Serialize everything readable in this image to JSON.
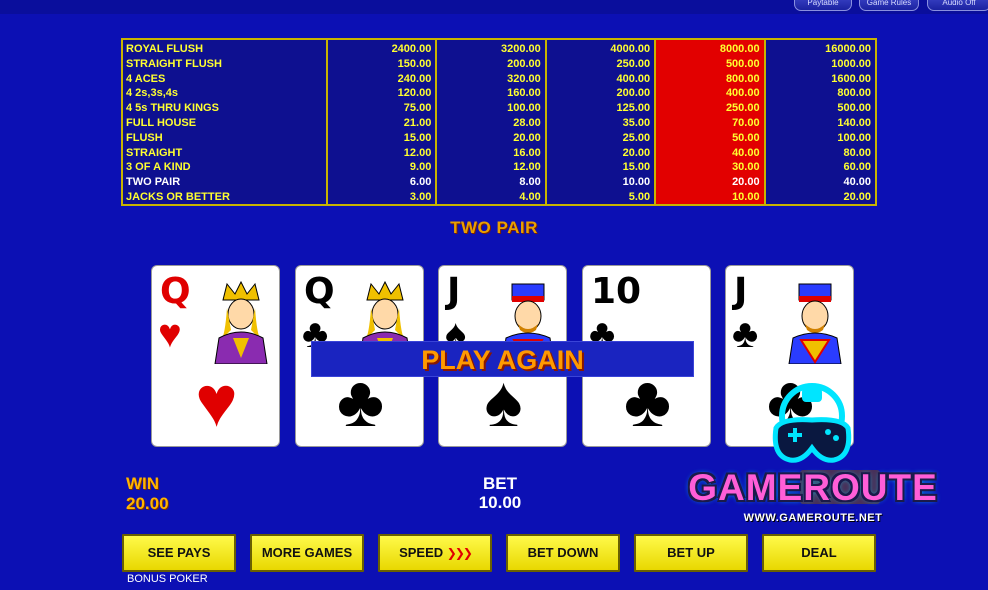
{
  "top_buttons": [
    "Paytable",
    "Game Rules",
    "Audio Off"
  ],
  "paytable": {
    "hands": [
      "ROYAL FLUSH",
      "STRAIGHT FLUSH",
      "4 ACES",
      "4 2s,3s,4s",
      "4 5s THRU KINGS",
      "FULL HOUSE",
      "FLUSH",
      "STRAIGHT",
      "3 OF A KIND",
      "TWO PAIR",
      "JACKS OR BETTER"
    ],
    "columns": [
      [
        "2400.00",
        "150.00",
        "240.00",
        "120.00",
        "75.00",
        "21.00",
        "15.00",
        "12.00",
        "9.00",
        "6.00",
        "3.00"
      ],
      [
        "3200.00",
        "200.00",
        "320.00",
        "160.00",
        "100.00",
        "28.00",
        "20.00",
        "16.00",
        "12.00",
        "8.00",
        "4.00"
      ],
      [
        "4000.00",
        "250.00",
        "400.00",
        "200.00",
        "125.00",
        "35.00",
        "25.00",
        "20.00",
        "15.00",
        "10.00",
        "5.00"
      ],
      [
        "8000.00",
        "500.00",
        "800.00",
        "400.00",
        "250.00",
        "70.00",
        "50.00",
        "40.00",
        "30.00",
        "20.00",
        "10.00"
      ],
      [
        "16000.00",
        "1000.00",
        "1600.00",
        "800.00",
        "500.00",
        "140.00",
        "100.00",
        "80.00",
        "60.00",
        "40.00",
        "20.00"
      ]
    ],
    "highlight_column_index": 3,
    "winning_hand_index": 9,
    "colors": {
      "text": "#ffff30",
      "border": "#c8b400",
      "highlight": "#e20000"
    }
  },
  "hand_result": "TWO PAIR",
  "cards": [
    {
      "rank": "Q",
      "suit": "♥",
      "color": "red",
      "face": "queen"
    },
    {
      "rank": "Q",
      "suit": "♣",
      "color": "black",
      "face": "queen"
    },
    {
      "rank": "J",
      "suit": "♠",
      "color": "black",
      "face": "jack"
    },
    {
      "rank": "10",
      "suit": "♣",
      "color": "black",
      "face": ""
    },
    {
      "rank": "J",
      "suit": "♣",
      "color": "black",
      "face": "jack"
    }
  ],
  "play_again": "PLAY AGAIN",
  "win": {
    "label": "WIN",
    "value": "20.00"
  },
  "bet": {
    "label": "BET",
    "value": "10.00"
  },
  "watermark": {
    "brand": "GAMEROUTE",
    "url": "WWW.GAMEROUTE.NET"
  },
  "buttons": {
    "see_pays": "SEE PAYS",
    "more_games": "MORE GAMES",
    "speed": "SPEED",
    "bet_down": "BET DOWN",
    "bet_up": "BET UP",
    "deal": "DEAL"
  },
  "game_name": "BONUS POKER",
  "colors": {
    "background": "#0c10b4",
    "button": "#fff94a",
    "win_text": "#ffb400"
  }
}
